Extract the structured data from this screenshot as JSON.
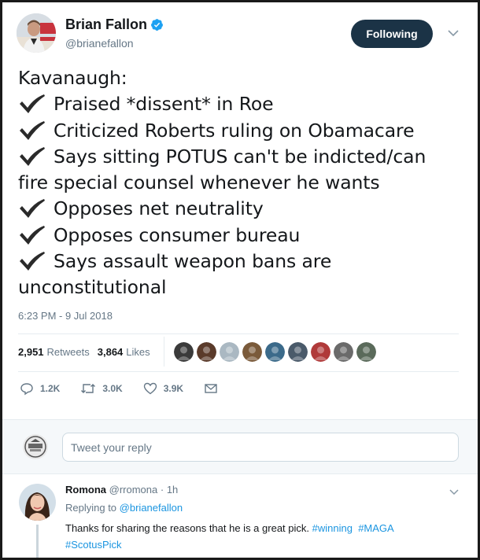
{
  "tweet": {
    "author_name": "Brian Fallon",
    "author_handle": "@brianefallon",
    "follow_label": "Following",
    "lines": [
      {
        "check": false,
        "text": "Kavanaugh:"
      },
      {
        "check": true,
        "text": "Praised *dissent* in Roe"
      },
      {
        "check": true,
        "text": "Criticized Roberts ruling on Obamacare"
      },
      {
        "check": true,
        "text": "Says sitting POTUS can't be indicted/can"
      },
      {
        "check": false,
        "text": "fire special counsel whenever he wants"
      },
      {
        "check": true,
        "text": "Opposes net neutrality"
      },
      {
        "check": true,
        "text": "Opposes consumer bureau"
      },
      {
        "check": true,
        "text": "Says assault weapon bans are"
      },
      {
        "check": false,
        "text": "unconstitutional"
      }
    ],
    "timestamp": "6:23 PM - 9 Jul 2018",
    "retweet_count": "2,951",
    "retweet_label": "Retweets",
    "like_count": "3,864",
    "like_label": "Likes",
    "actions": {
      "reply_count": "1.2K",
      "retweet_count": "3.0K",
      "like_count": "3.9K"
    },
    "liker_avatar_colors": [
      "#3a3a3a",
      "#5a3a2a",
      "#aab8c2",
      "#7a5a3a",
      "#3b6a8a",
      "#4a5a6a",
      "#b03a3a",
      "#6a6a6a",
      "#5a6a5a"
    ]
  },
  "reply_box": {
    "placeholder": "Tweet your reply"
  },
  "reply": {
    "name": "Romona",
    "handle": "@rromona",
    "separator": "·",
    "time": "1h",
    "replying_prefix": "Replying to",
    "replying_to": "@brianefallon",
    "text_plain": "Thanks for sharing the reasons that he is a great pick.",
    "tag1": "#winning",
    "tag2": "#MAGA",
    "tag3": "#ScotusPick"
  },
  "colors": {
    "accent": "#1b95e0",
    "follow_button": "#1b3346",
    "muted": "#657786"
  }
}
